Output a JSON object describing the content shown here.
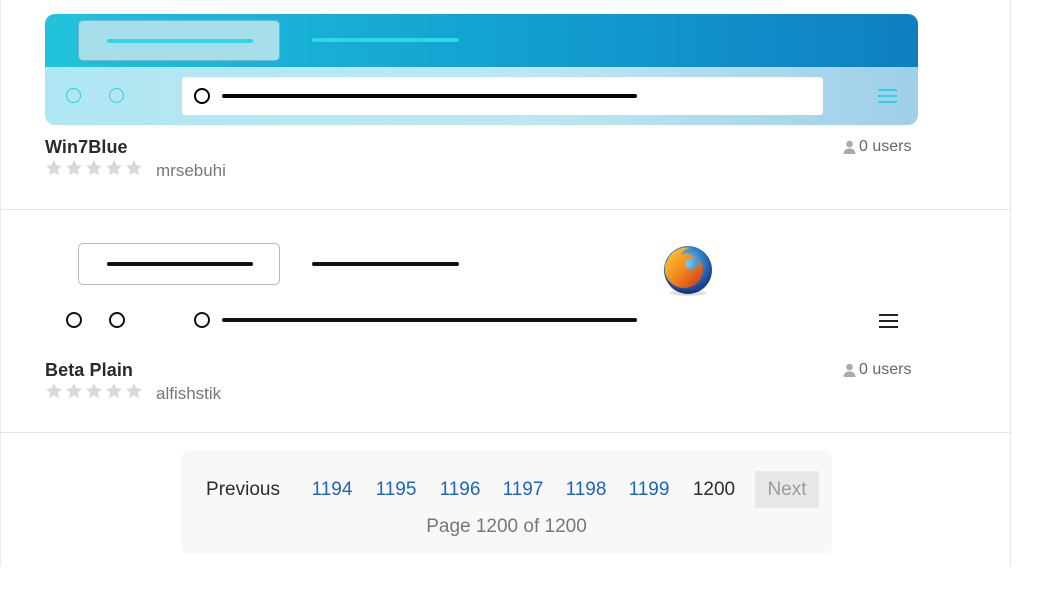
{
  "themes": [
    {
      "name": "Win7Blue",
      "author": "mrsebuhi",
      "users": "0 users",
      "rating_stars": 0,
      "colors": {
        "header_start": "#22c2dc",
        "header_end": "#0f7fc2",
        "toolbar": "#aee7f3",
        "accent": "#2ed6e6"
      }
    },
    {
      "name": "Beta Plain",
      "author": "alfishstik",
      "users": "0 users",
      "rating_stars": 0,
      "colors": {
        "background": "#ffffff",
        "accent": "#111111"
      }
    }
  ],
  "pagination": {
    "previous_label": "Previous",
    "pages": [
      "1194",
      "1195",
      "1196",
      "1197",
      "1198",
      "1199"
    ],
    "current_page": "1200",
    "next_label": "Next",
    "info": "Page 1200 of 1200"
  },
  "icons": {
    "user": "user-icon",
    "star": "star-icon",
    "menu": "hamburger-menu-icon",
    "browser_logo": "firefox-logo-icon"
  }
}
